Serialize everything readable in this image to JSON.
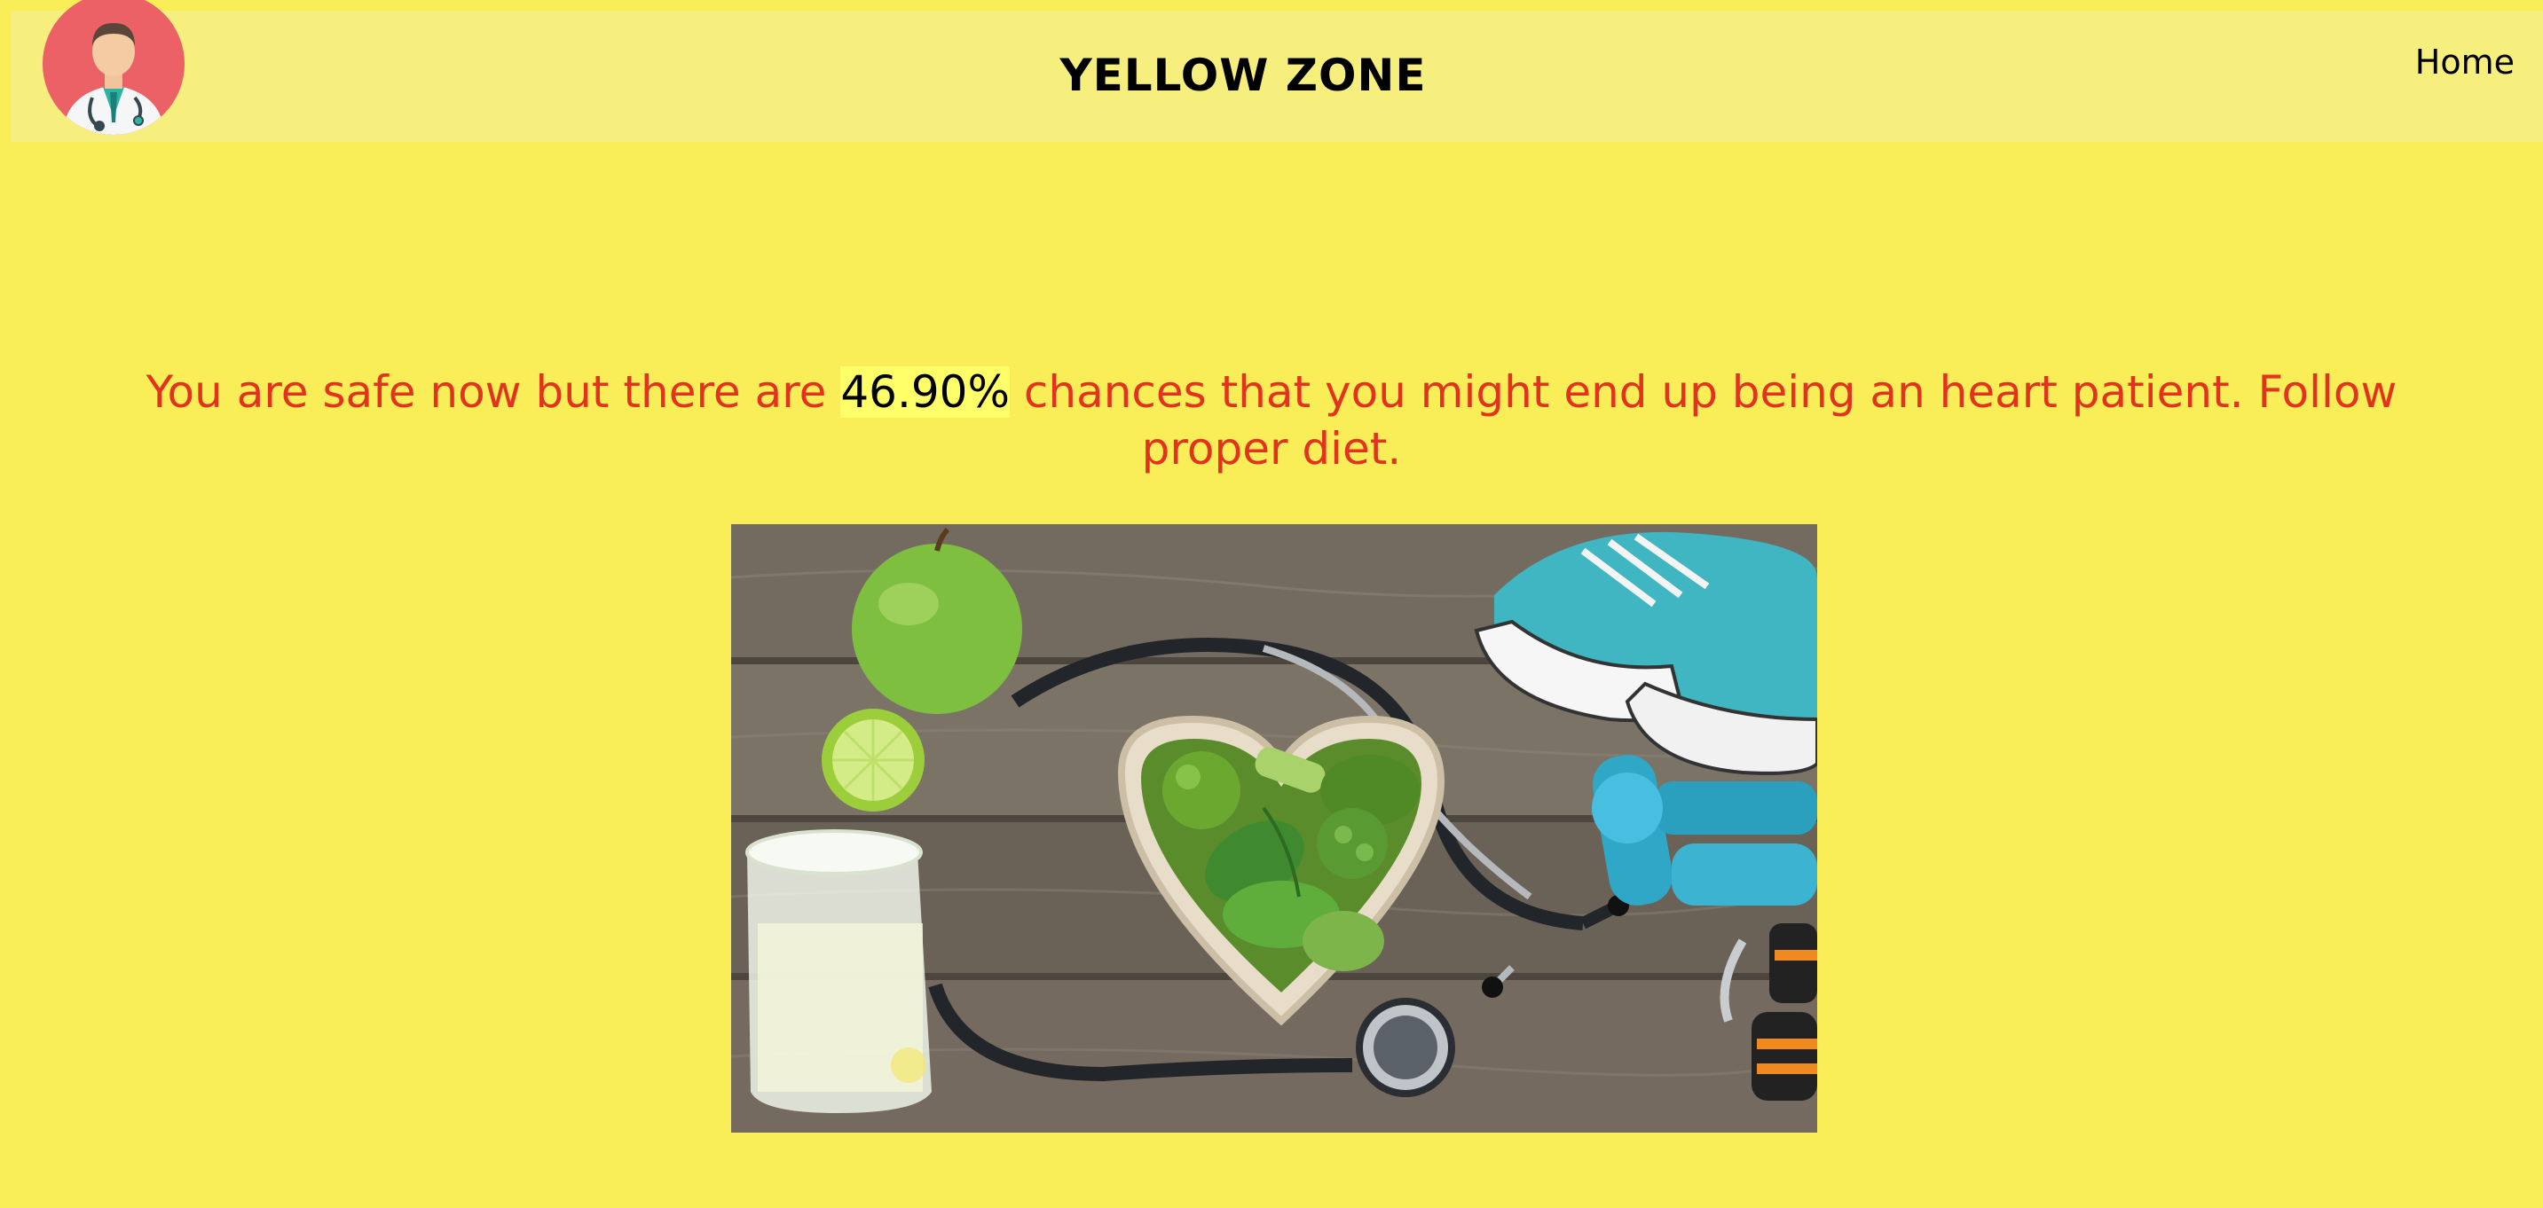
{
  "header": {
    "title": "YELLOW ZONE",
    "nav_home": "Home",
    "logo_icon": "doctor-avatar-icon"
  },
  "result": {
    "text_before": "You are safe now but there are",
    "percentage": "46.90%",
    "text_after": "chances that you might end up being an heart patient. Follow proper diet."
  },
  "image": {
    "subject": "healthy-lifestyle-photo"
  },
  "colors": {
    "background": "#f9ee57",
    "navbar": "#f7ef7d",
    "message_text": "#e2331f",
    "highlight": "#ffff6a"
  }
}
